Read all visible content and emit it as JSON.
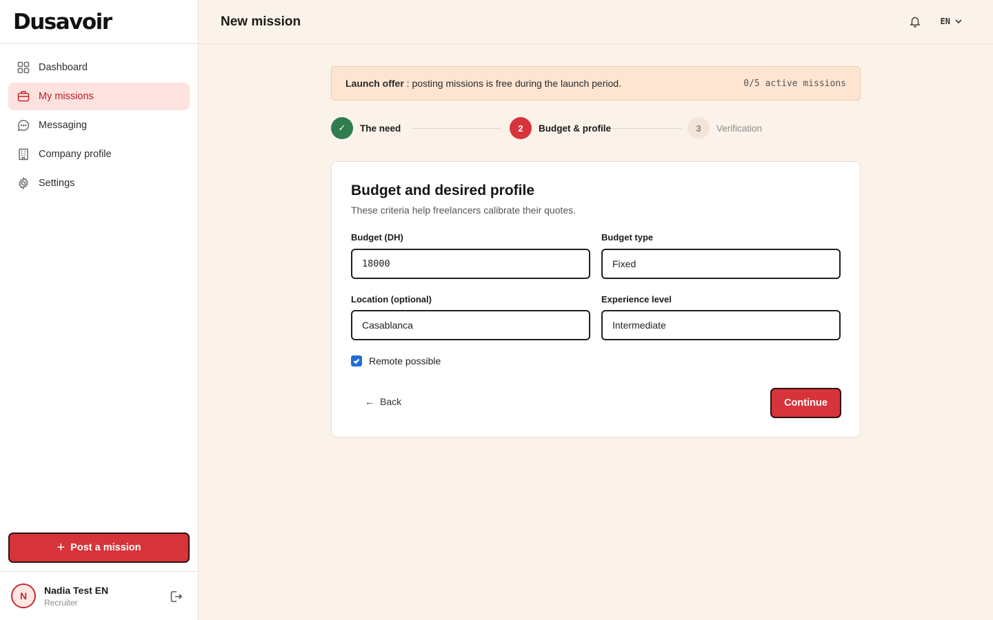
{
  "brand": {
    "logo_text": "Dusavoir"
  },
  "sidebar": {
    "items": [
      {
        "label": "Dashboard",
        "icon": "grid-icon",
        "active": false
      },
      {
        "label": "My missions",
        "icon": "briefcase-icon",
        "active": true
      },
      {
        "label": "Messaging",
        "icon": "chat-bubble-icon",
        "active": false
      },
      {
        "label": "Company profile",
        "icon": "building-icon",
        "active": false
      },
      {
        "label": "Settings",
        "icon": "gear-icon",
        "active": false
      }
    ],
    "post_button": {
      "icon": "+",
      "label": "Post a mission"
    }
  },
  "user": {
    "initial": "N",
    "name": "Nadia Test EN",
    "role": "Recruiter"
  },
  "header": {
    "title": "New mission",
    "language": "EN"
  },
  "banner": {
    "strong": "Launch offer",
    "text": " : posting missions is free during the launch period.",
    "count": "0/5 active missions"
  },
  "stepper": {
    "steps": [
      {
        "marker": "✓",
        "label": "The need",
        "state": "done"
      },
      {
        "marker": "2",
        "label": "Budget & profile",
        "state": "current"
      },
      {
        "marker": "3",
        "label": "Verification",
        "state": "upcoming"
      }
    ]
  },
  "form": {
    "title": "Budget and desired profile",
    "subtitle": "These criteria help freelancers calibrate their quotes.",
    "budget": {
      "label": "Budget (DH)",
      "value": "18000"
    },
    "budget_type": {
      "label": "Budget type",
      "value": "Fixed"
    },
    "location": {
      "label": "Location (optional)",
      "value": "Casablanca"
    },
    "experience": {
      "label": "Experience level",
      "value": "Intermediate"
    },
    "remote": {
      "label": "Remote possible",
      "checked": true
    },
    "back_label": "Back",
    "back_arrow": "←",
    "continue_label": "Continue"
  },
  "colors": {
    "accent": "#d6333a",
    "success": "#2e7d4f",
    "page_bg": "#fbf3ea",
    "banner_bg": "#fde5d2",
    "checkbox": "#1f6fd6"
  }
}
